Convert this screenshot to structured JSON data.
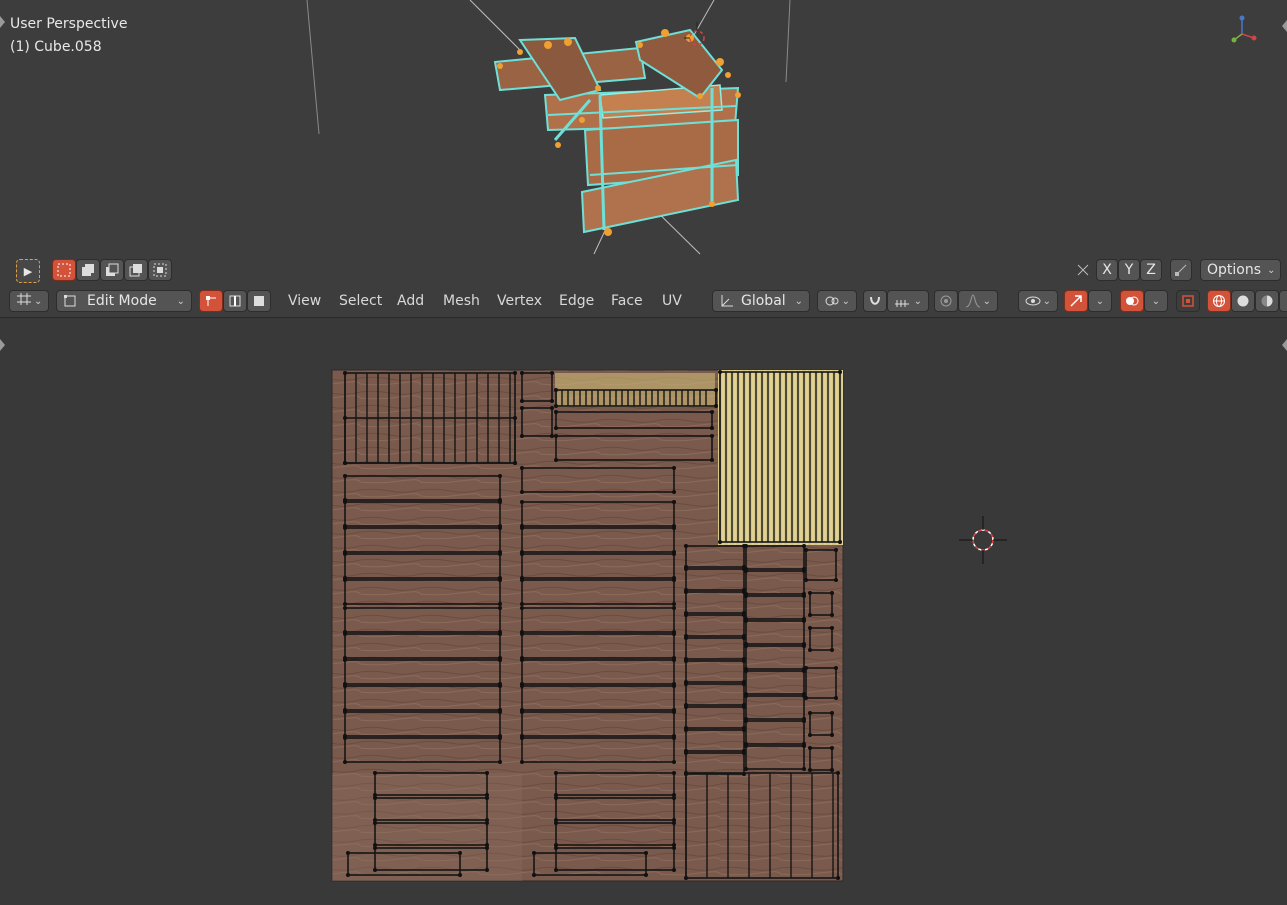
{
  "viewport": {
    "perspective_label": "User Perspective",
    "object_label": "(1) Cube.058"
  },
  "toolbar_top": {
    "axes": [
      "X",
      "Y",
      "Z"
    ],
    "options_label": "Options",
    "icons": [
      "select-box-tool-icon",
      "select-new-icon",
      "select-extend-icon",
      "select-subtract-icon",
      "select-invert-icon",
      "select-intersect-icon",
      "mirror-icon",
      "snap-toggle-icon"
    ]
  },
  "header": {
    "editor_type_icon": "uv-editor-icon",
    "mode": "Edit Mode",
    "menus": [
      "View",
      "Select",
      "Add",
      "Mesh",
      "Vertex",
      "Edge",
      "Face",
      "UV"
    ],
    "transform_orientation": "Global",
    "colors": {
      "accent": "#d3533a",
      "background": "#393939",
      "button": "#545454"
    }
  },
  "uv_editor": {
    "texture": "wood-plank-texture"
  }
}
